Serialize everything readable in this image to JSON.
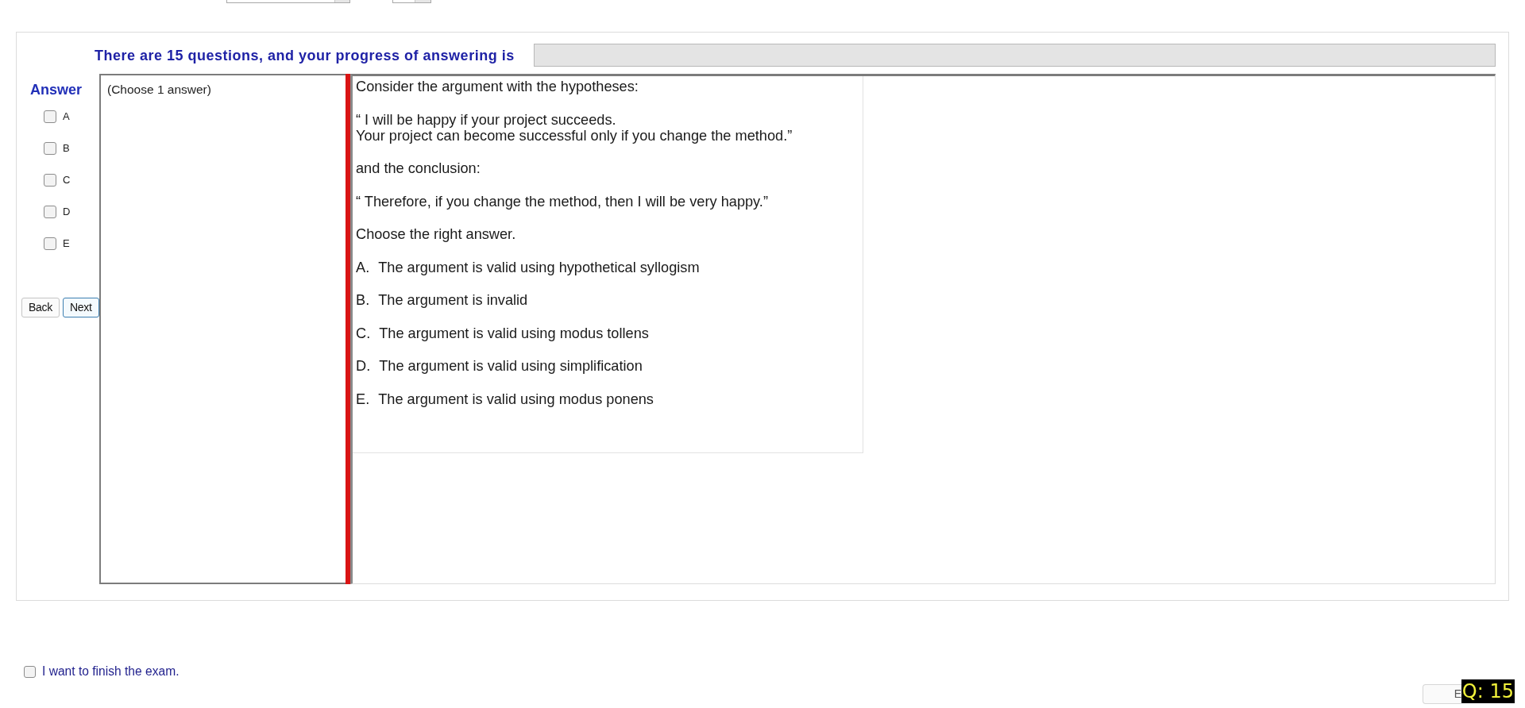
{
  "header": {
    "progress_label": "There are 15 questions, and your progress of answering is",
    "progress": {
      "level": 0
    }
  },
  "answer_panel": {
    "title": "Answer",
    "options": [
      {
        "label": "A",
        "checked": false
      },
      {
        "label": "B",
        "checked": false
      },
      {
        "label": "C",
        "checked": false
      },
      {
        "label": "D",
        "checked": false
      },
      {
        "label": "E",
        "checked": false
      }
    ],
    "buttons": [
      {
        "label": "Back",
        "focused": false
      },
      {
        "label": "Next",
        "focused": true
      }
    ]
  },
  "answer_box": {
    "instruction": "(Choose 1 answer)"
  },
  "question": {
    "paragraphs": [
      "Consider the argument with the hypotheses:",
      "“ I will be happy if your project succeeds.\nYour project can become successful only if you change the method.”",
      "and the conclusion:",
      "“ Therefore, if you change the method, then I will be very happy.”",
      "Choose the right answer."
    ],
    "choices": [
      {
        "letter": "A.",
        "text": "The argument is valid using hypothetical syllogism"
      },
      {
        "letter": "B.",
        "text": "The argument is invalid"
      },
      {
        "letter": "C.",
        "text": "The argument is valid using modus tollens"
      },
      {
        "letter": "D.",
        "text": "The argument is valid using simplification"
      },
      {
        "letter": "E.",
        "text": "The argument is valid using modus ponens"
      }
    ]
  },
  "footer": {
    "finish": {
      "label": "I want to finish the exam.",
      "checked": false
    },
    "exit_button": {
      "label": "E"
    },
    "question_badge": "Q: 15"
  }
}
